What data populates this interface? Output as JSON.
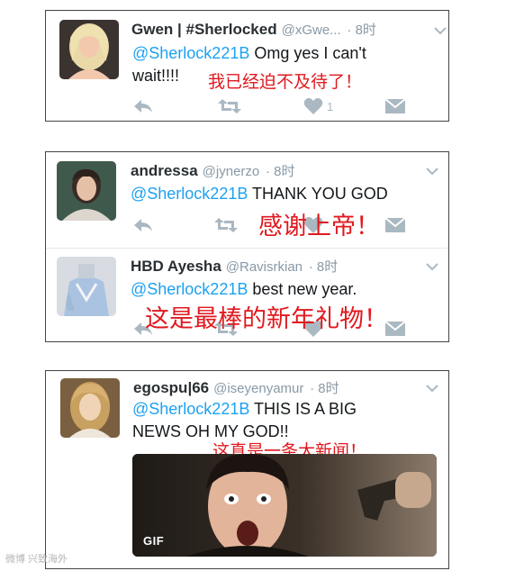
{
  "tweets": [
    {
      "name": "Gwen | #Sherlocked",
      "handle": "@xGwe...",
      "time": "· 8时",
      "mention": "@Sherlock221B",
      "text_line1": " Omg yes I can't",
      "text_line2": "wait!!!!",
      "caption": "我已经迫不及待了！",
      "like_count": "1"
    },
    {
      "name": "andressa",
      "handle": "@jynerzo",
      "time": "· 8时",
      "mention": "@Sherlock221B",
      "text": " THANK YOU GOD",
      "caption": "感谢上帝！"
    },
    {
      "name": "HBD Ayesha",
      "handle": "@Ravisrkian",
      "time": "· 8时",
      "mention": "@Sherlock221B",
      "text": " best new year.",
      "caption": "这是最棒的新年礼物！"
    },
    {
      "name": "egospu|66",
      "handle": "@iseyenyamur",
      "time": "· 8时",
      "mention": "@Sherlock221B",
      "text_line1": " THIS IS A BIG",
      "text_line2": "NEWS OH MY GOD!!",
      "caption": "这真是一条大新闻！",
      "media_label": "GIF"
    }
  ],
  "icons": {
    "reply": "reply-icon",
    "retweet": "retweet-icon",
    "like": "heart-icon",
    "dm": "envelope-icon",
    "more": "chevron-down-icon"
  },
  "colors": {
    "mention": "#1da1f2",
    "caption": "#e0191f",
    "icon": "#aab8c2",
    "handle": "#8899a6"
  },
  "watermark": "微博 兴致海外"
}
